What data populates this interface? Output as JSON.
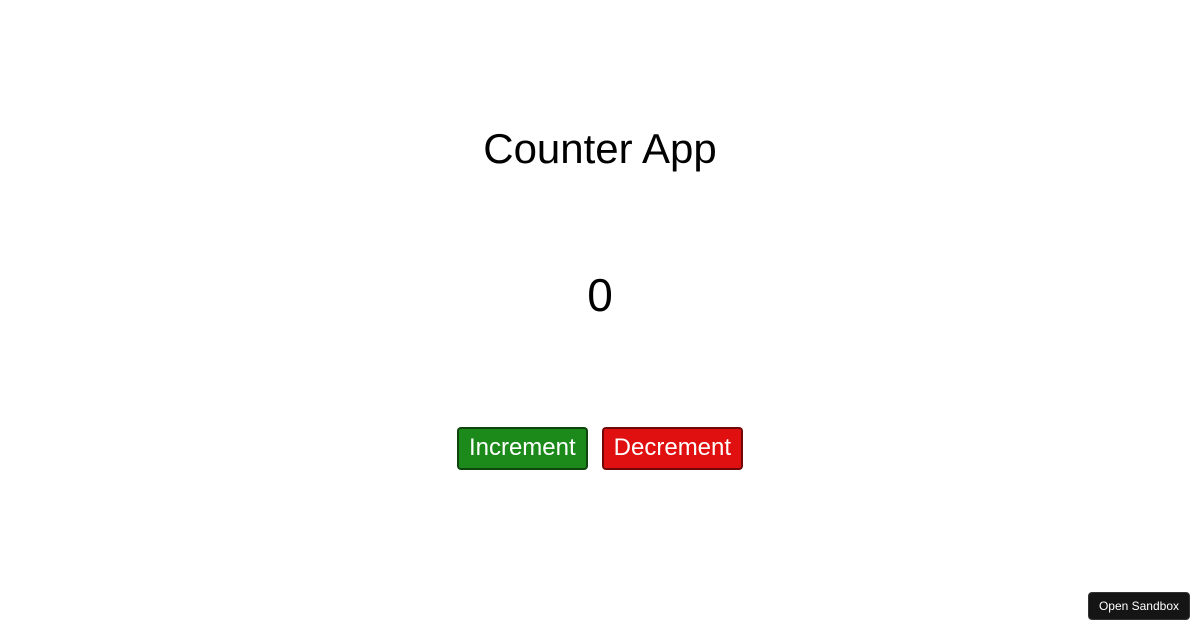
{
  "header": {
    "title": "Counter App"
  },
  "counter": {
    "value": "0"
  },
  "buttons": {
    "increment_label": "Increment",
    "decrement_label": "Decrement"
  },
  "footer": {
    "open_sandbox_label": "Open Sandbox"
  },
  "colors": {
    "increment_bg": "#1b8a1b",
    "decrement_bg": "#e01010",
    "sandbox_bg": "#151515"
  }
}
